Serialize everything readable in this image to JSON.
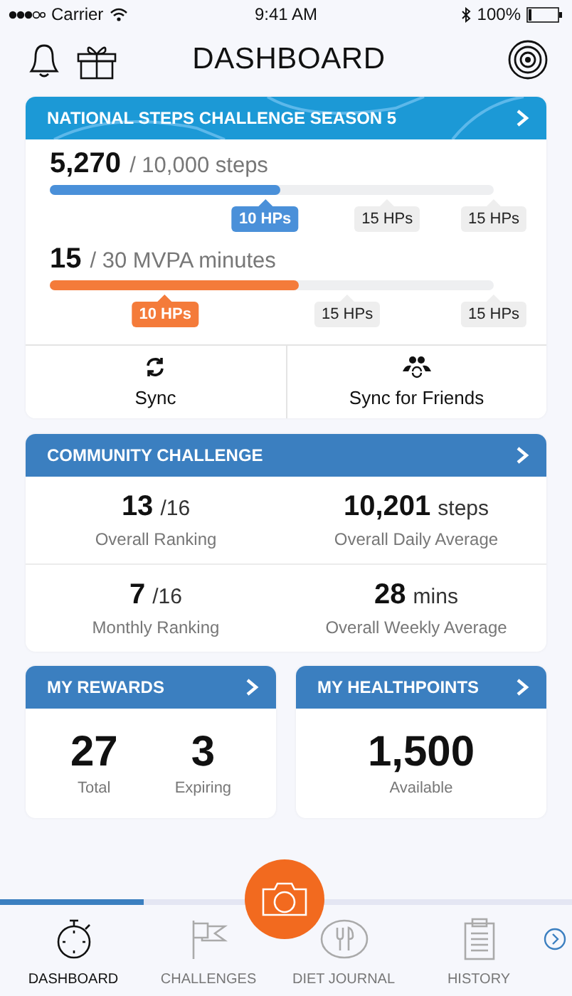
{
  "status_bar": {
    "carrier": "Carrier",
    "time": "9:41 AM",
    "battery": "100%"
  },
  "header": {
    "title": "DASHBOARD"
  },
  "steps_challenge": {
    "title": "NATIONAL STEPS CHALLENGE SEASON 5",
    "goals": [
      {
        "value": "5,270",
        "target": "/ 10,000 steps",
        "level": 0.52,
        "color": "#4a90d9",
        "milestones": [
          {
            "label": "10 HPs",
            "reached": true
          },
          {
            "label": "15 HPs",
            "reached": false
          },
          {
            "label": "15 HPs",
            "reached": false
          }
        ]
      },
      {
        "value": "15",
        "target": "/ 30 MVPA minutes",
        "level": 0.56,
        "color": "#f47b3a",
        "milestones": [
          {
            "label": "10 HPs",
            "reached": true
          },
          {
            "label": "15 HPs",
            "reached": false
          },
          {
            "label": "15 HPs",
            "reached": false
          }
        ]
      }
    ],
    "actions": [
      {
        "kind": "sync",
        "label": "Sync"
      },
      {
        "kind": "friends",
        "label": "Sync for Friends"
      }
    ]
  },
  "community_challenge": {
    "title": "COMMUNITY CHALLENGE",
    "stats": [
      {
        "value": "13",
        "unit": "/16",
        "label": "Overall Ranking"
      },
      {
        "value": "10,201",
        "unit": "steps",
        "label": "Overall Daily Average"
      },
      {
        "value": "7",
        "unit": "/16",
        "label": "Monthly Ranking"
      },
      {
        "value": "28",
        "unit": "mins",
        "label": "Overall Weekly Average"
      }
    ]
  },
  "my_rewards": {
    "title": "MY REWARDS",
    "stats": [
      {
        "value": "27",
        "label": "Total"
      },
      {
        "value": "3",
        "label": "Expiring"
      }
    ]
  },
  "my_healthpoints": {
    "title": "MY HEALTHPOINTS",
    "stats": [
      {
        "value": "1,500",
        "label": "Available"
      }
    ]
  },
  "tab_bar": {
    "progress": {
      "level": 0.25
    },
    "tabs": [
      {
        "kind": "dashboard",
        "label": "DASHBOARD",
        "selected": true
      },
      {
        "kind": "challenges",
        "label": "CHALLENGES",
        "selected": false
      },
      {
        "kind": "diet",
        "label": "DIET JOURNAL",
        "selected": false
      },
      {
        "kind": "history",
        "label": "HISTORY",
        "selected": false
      }
    ]
  }
}
